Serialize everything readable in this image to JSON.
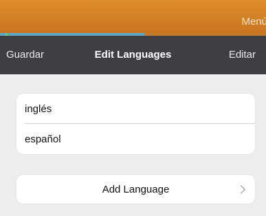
{
  "top_bar": {
    "menu_label": "Menú",
    "progress_fraction": 0.54
  },
  "nav": {
    "left_label": "Guardar",
    "title": "Edit Languages",
    "right_label": "Editar"
  },
  "languages": [
    {
      "name": "inglés"
    },
    {
      "name": "español"
    }
  ],
  "add_language": {
    "label": "Add Language",
    "icon": "chevron-right-icon"
  },
  "colors": {
    "accent_orange": "#de8d2c",
    "nav_background": "#3f3f43",
    "progress_blue": "#5aa8c6"
  }
}
